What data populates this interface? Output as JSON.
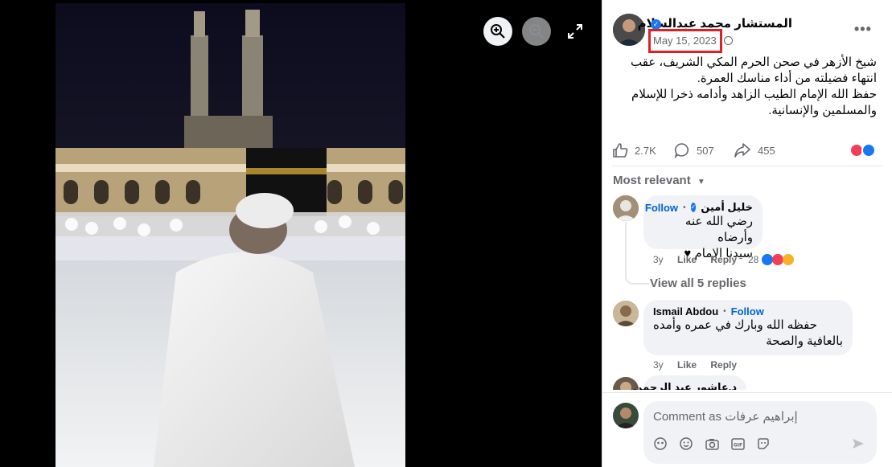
{
  "viewer": {
    "zoom_in_icon": "zoom-in-icon",
    "zoom_out_icon": "zoom-out-icon",
    "expand_icon": "expand-icon"
  },
  "post": {
    "author": "المستشار محمد عبدالسلام",
    "date": "May 15, 2023",
    "separator": "·",
    "text_lines": [
      "شيخ الأزهر في صحن الحرم المكي الشريف، عقب",
      "انتهاء فضيلته من أداء مناسك العمرة.",
      "حفظ الله الإمام الطيب الزاهد وأدامه ذخرا للإسلام",
      "والمسلمين والإنسانية."
    ],
    "likes": "2.7K",
    "comments": "507",
    "shares": "455"
  },
  "sort_label": "Most relevant",
  "comments": [
    {
      "name": "خليل أمين",
      "follow": "Follow",
      "text_lines": [
        "رضي الله عنه وأرضاه",
        "سيدنا الإمام ♥"
      ],
      "age": "3y",
      "like": "Like",
      "reply": "Reply",
      "reaction_count": "28",
      "view_replies": "View all 5 replies"
    },
    {
      "name": "Ismail Abdou",
      "follow": "Follow",
      "text_lines": [
        "حفظه الله وبارك في عمره وأمده",
        "بالعافية والصحة"
      ],
      "age": "3y",
      "like": "Like",
      "reply": "Reply"
    },
    {
      "name": "د.عاشور عبد الرحمن"
    }
  ],
  "compose": {
    "placeholder": "Comment as إبراهيم عرفات"
  },
  "colors": {
    "accent": "#0064d1",
    "highlight_box": "#e02020",
    "like_blue": "#1877f2",
    "love_red": "#f33e58"
  }
}
